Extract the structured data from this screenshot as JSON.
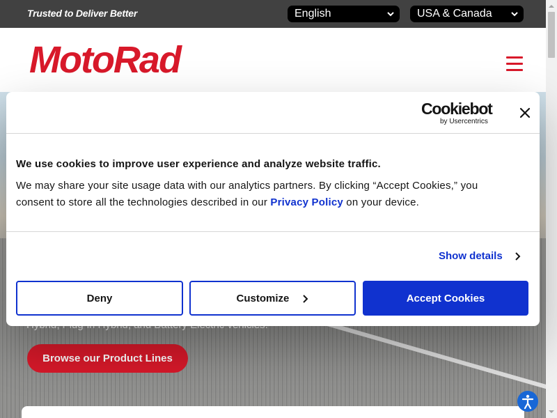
{
  "topbar": {
    "tagline": "Trusted to Deliver Better",
    "language_select": {
      "value": "English",
      "icon": "chevron-down-icon"
    },
    "region_select": {
      "value": "USA & Canada",
      "icon": "chevron-down-icon"
    }
  },
  "header": {
    "logo_text": "MotoRad",
    "menu_icon": "hamburger-menu-icon"
  },
  "hero": {
    "subtitle_fragment": "Hybrid, Plug-in Hybrid, and Battery Electric vehicles.",
    "cta_label": "Browse our Product Lines",
    "accessibility_icon": "accessibility-icon"
  },
  "cookie_dialog": {
    "brand": "Cookiebot",
    "brand_sub": "by Usercentrics",
    "close_icon": "close-icon",
    "title": "We use cookies to improve user experience and analyze website traffic.",
    "body_before": "We may share your site usage data with our analytics partners. By clicking “Accept Cookies,” you consent to store all the technologies described in our ",
    "body_link": "Privacy Policy",
    "body_after": " on your device.",
    "show_details": "Show details",
    "deny": "Deny",
    "customize": "Customize",
    "accept": "Accept Cookies"
  },
  "colors": {
    "brand_red": "#d8192a",
    "cookie_blue": "#1032cf",
    "topbar_bg": "#414141"
  }
}
